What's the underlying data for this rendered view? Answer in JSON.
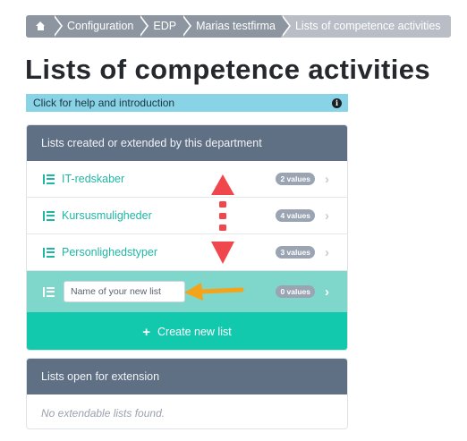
{
  "breadcrumb": {
    "home_icon": "home-icon",
    "items": [
      "Configuration",
      "EDP",
      "Marias testfirma",
      "Lists of competence activities"
    ]
  },
  "page": {
    "title": "Lists of competence activities"
  },
  "help_bar": {
    "label": "Click for help and introduction",
    "icon": "info-icon",
    "info_glyph": "i",
    "color": "#89d3e6"
  },
  "department_lists": {
    "header": "Lists created or extended by this department",
    "items": [
      {
        "label": "IT-redskaber",
        "badge": "2 values"
      },
      {
        "label": "Kursusmuligheder",
        "badge": "4 values"
      },
      {
        "label": "Personlighedstyper",
        "badge": "3 values"
      }
    ],
    "new_list": {
      "placeholder": "Name of your new list",
      "value": "",
      "badge": "0 values"
    },
    "create_button": {
      "plus": "+",
      "label": "Create new list"
    }
  },
  "extension_lists": {
    "header": "Lists open for extension",
    "empty_text": "No extendable lists found."
  },
  "colors": {
    "accent": "#13c9ad",
    "link": "#1fb7a4",
    "panel_header": "#5f6f84",
    "annotation_red": "#f0474c",
    "annotation_orange": "#f5a31a"
  },
  "icons": {
    "chevron": "chevron-right-icon",
    "list": "list-icon"
  }
}
